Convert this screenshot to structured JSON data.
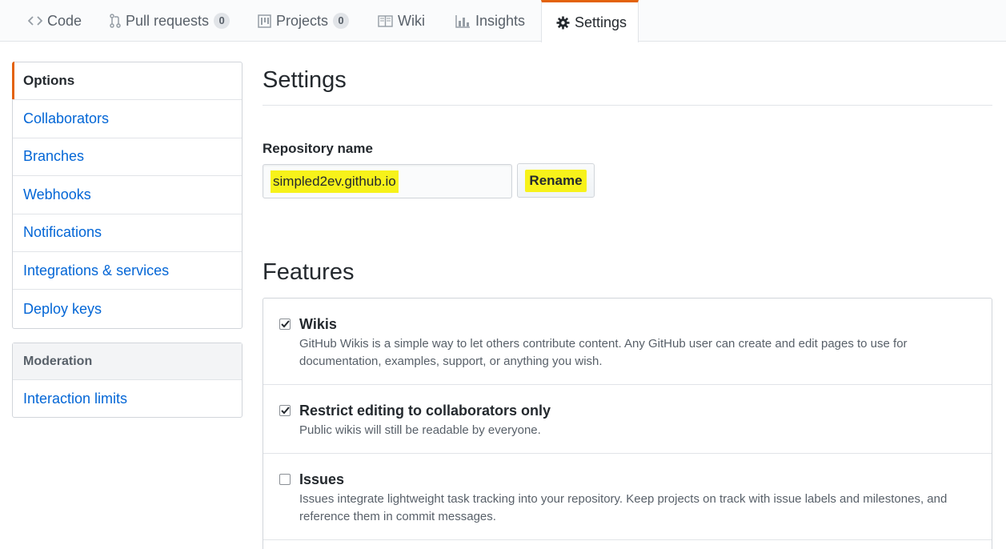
{
  "tabs": [
    {
      "label": "Code",
      "icon": "code-icon"
    },
    {
      "label": "Pull requests",
      "icon": "pull-request-icon",
      "count": "0"
    },
    {
      "label": "Projects",
      "icon": "project-icon",
      "count": "0"
    },
    {
      "label": "Wiki",
      "icon": "book-icon"
    },
    {
      "label": "Insights",
      "icon": "graph-icon"
    },
    {
      "label": "Settings",
      "icon": "gear-icon",
      "selected": true
    }
  ],
  "sidebar": {
    "items": [
      {
        "label": "Options",
        "selected": true
      },
      {
        "label": "Collaborators"
      },
      {
        "label": "Branches"
      },
      {
        "label": "Webhooks"
      },
      {
        "label": "Notifications"
      },
      {
        "label": "Integrations & services"
      },
      {
        "label": "Deploy keys"
      }
    ],
    "moderation": {
      "heading": "Moderation",
      "items": [
        {
          "label": "Interaction limits"
        }
      ]
    }
  },
  "main": {
    "title": "Settings",
    "repo_name_label": "Repository name",
    "repo_name_value": "simpled2ev.github.io",
    "rename_label": "Rename",
    "features_title": "Features",
    "features": [
      {
        "title": "Wikis",
        "checked": true,
        "desc": "GitHub Wikis is a simple way to let others contribute content. Any GitHub user can create and edit pages to use for documentation, examples, support, or anything you wish."
      },
      {
        "title": "Restrict editing to collaborators only",
        "checked": true,
        "desc": "Public wikis will still be readable by everyone."
      },
      {
        "title": "Issues",
        "checked": false,
        "desc": "Issues integrate lightweight task tracking into your repository. Keep projects on track with issue labels and milestones, and reference them in commit messages."
      }
    ]
  },
  "colors": {
    "accent": "#e36209",
    "link": "#0366d6",
    "highlight": "#f7f21a"
  }
}
